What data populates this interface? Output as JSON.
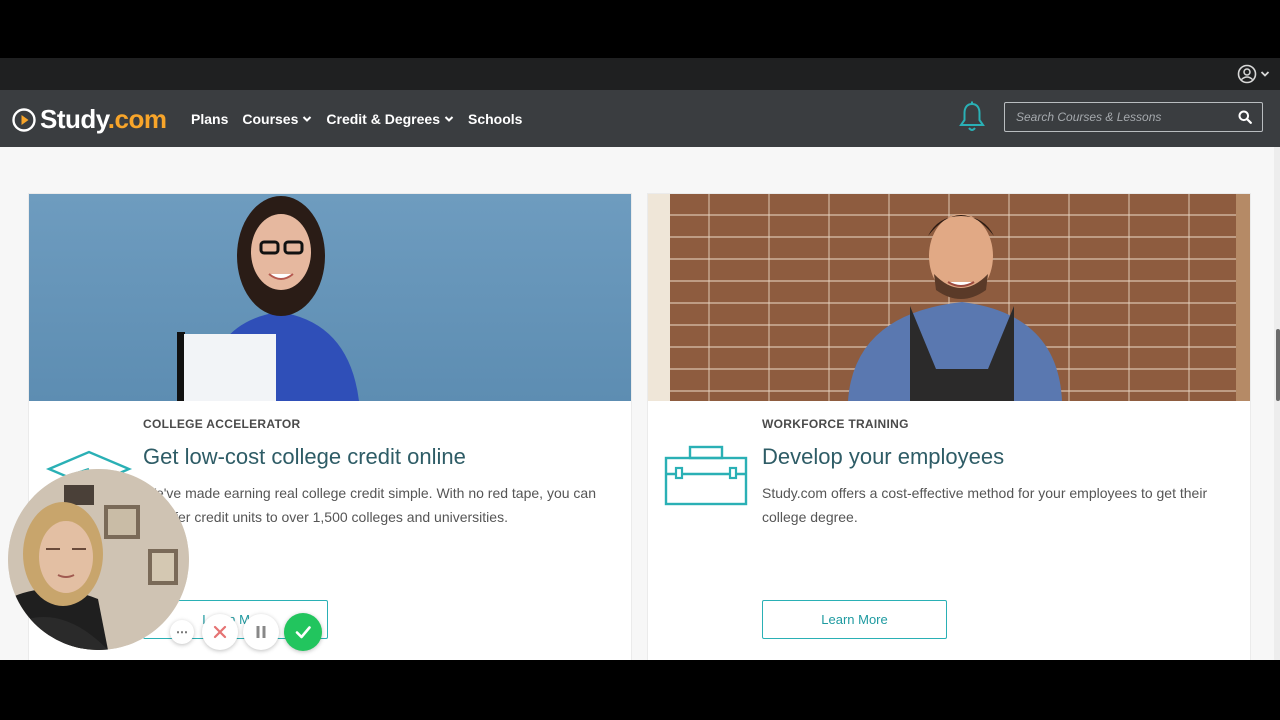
{
  "brand": {
    "name_main": "Study",
    "name_dot": ".com",
    "accent": "#f8a52a"
  },
  "nav": {
    "links": [
      {
        "label": "Plans",
        "dropdown": false
      },
      {
        "label": "Courses",
        "dropdown": true
      },
      {
        "label": "Credit & Degrees",
        "dropdown": true
      },
      {
        "label": "Schools",
        "dropdown": false
      }
    ]
  },
  "search": {
    "placeholder": "Search Courses & Lessons",
    "value": ""
  },
  "icons": {
    "user": "user-circle-icon",
    "bell": "bell-icon",
    "search": "search-icon"
  },
  "cards": [
    {
      "eyebrow": "COLLEGE ACCELERATOR",
      "title": "Get low-cost college credit online",
      "description": "We've made earning real college credit simple. With no red tape, you can transfer credit units to over 1,500 colleges and universities.",
      "button": "Learn More",
      "icon": "graduation-cap-icon"
    },
    {
      "eyebrow": "WORKFORCE TRAINING",
      "title": "Develop your employees",
      "description": "Study.com offers a cost-effective method for your employees to get their college degree.",
      "button": "Learn More",
      "icon": "briefcase-icon"
    }
  ],
  "recorder": {
    "more": "⋯",
    "colors": {
      "confirm": "#22c55e",
      "cancel": "#e57373"
    }
  },
  "colors": {
    "teal": "#2ab0b5",
    "nav_bg": "#3a3d40",
    "title": "#2e5c66"
  }
}
